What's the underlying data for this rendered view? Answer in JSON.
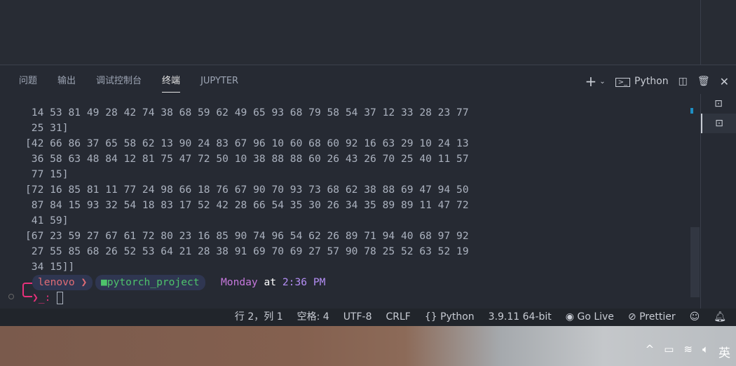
{
  "panel": {
    "tabs": [
      "问题",
      "输出",
      "调试控制台",
      "终端",
      "JUPYTER"
    ],
    "active_tab": "终端",
    "terminal_profile": "Python"
  },
  "terminal": {
    "lines": [
      " 14 53 81 49 28 42 74 38 68 59 62 49 65 93 68 79 58 54 37 12 33 28 23 77",
      " 25 31]",
      "[42 66 86 37 65 58 62 13 90 24 83 67 96 10 60 68 60 92 16 63 29 10 24 13",
      " 36 58 63 48 84 12 81 75 47 72 50 10 38 88 88 60 26 43 26 70 25 40 11 57",
      " 77 15]",
      "[72 16 85 81 11 77 24 98 66 18 76 67 90 70 93 73 68 62 38 88 69 47 94 50",
      " 87 84 15 93 32 54 18 83 17 52 42 28 66 54 35 30 26 34 35 89 89 11 47 72",
      " 41 59]",
      "[67 23 59 27 67 61 72 80 23 16 85 90 74 96 54 62 26 89 71 94 40 68 97 92",
      " 27 55 85 68 26 52 53 64 21 28 38 91 69 70 69 27 57 90 78 25 52 63 52 19",
      " 34 15]]"
    ],
    "prompt": {
      "user": "lenovo",
      "dir": "pytorch_project",
      "day": "Monday",
      "at": "at",
      "time": "2:36 PM",
      "symbol": "❯_:"
    }
  },
  "status": {
    "position": "行 2，列 1",
    "indent": "空格: 4",
    "encoding": "UTF-8",
    "eol": "CRLF",
    "language": "Python",
    "interpreter": "3.9.11 64-bit",
    "golive": "Go Live",
    "prettier": "Prettier"
  },
  "tray": {
    "ime": "英"
  },
  "colors": {
    "accent": "#1e8fc4",
    "user": "#e06c75",
    "dir": "#4ec26b",
    "day": "#c678dd",
    "time": "#b48ef5",
    "arrow": "#e8317b"
  }
}
